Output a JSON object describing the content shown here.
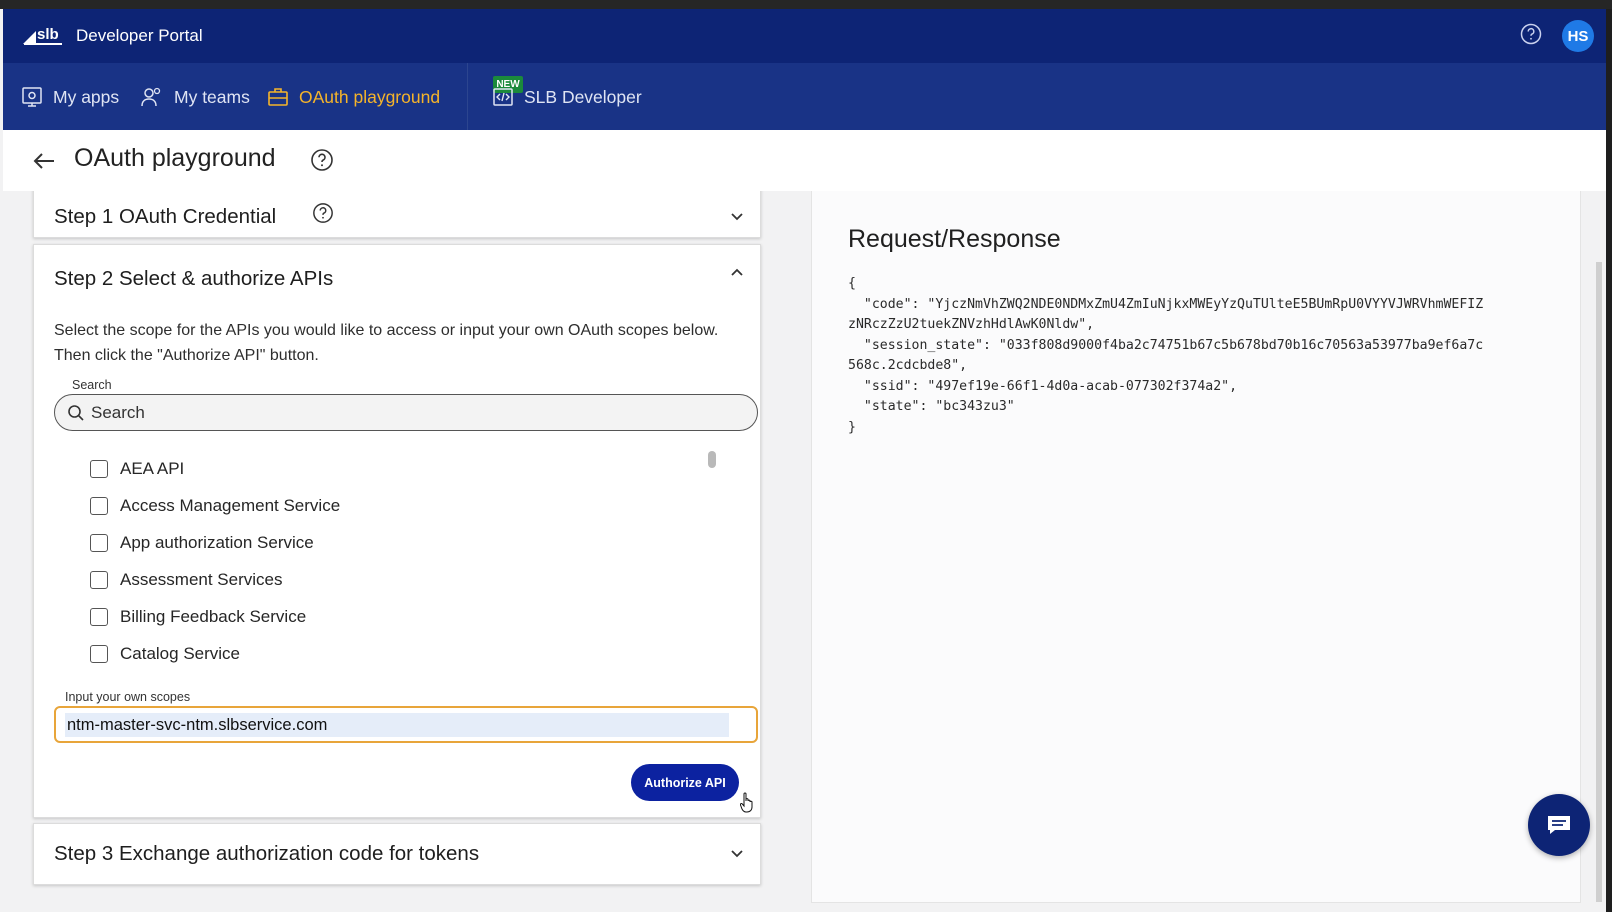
{
  "header": {
    "app_title": "Developer Portal",
    "avatar_initials": "HS",
    "brand_color": "#0d2475",
    "accent_color": "#f5b42a"
  },
  "nav": {
    "items": [
      {
        "label": "My apps",
        "icon": "apps-icon"
      },
      {
        "label": "My teams",
        "icon": "team-icon"
      },
      {
        "label": "OAuth playground",
        "icon": "briefcase-icon",
        "active": true
      },
      {
        "label": "SLB Developer",
        "icon": "code-icon",
        "badge": "NEW"
      }
    ]
  },
  "page": {
    "title": "OAuth playground"
  },
  "steps": {
    "step1": {
      "title": "Step 1 OAuth Credential"
    },
    "step2": {
      "title": "Step 2 Select & authorize APIs",
      "description": "Select the scope for the APIs you would like to access or input your own OAuth scopes below. Then click the \"Authorize API\" button.",
      "search_label": "Search",
      "search_placeholder": "Search",
      "apis": [
        "AEA API",
        "Access Management Service",
        "App authorization Service",
        "Assessment Services",
        "Billing Feedback Service",
        "Catalog Service"
      ],
      "scopes_label": "Input your own scopes",
      "scopes_value": "ntm-master-svc-ntm.slbservice.com",
      "authorize_label": "Authorize API"
    },
    "step3": {
      "title": "Step 3 Exchange authorization code for tokens"
    }
  },
  "response": {
    "title": "Request/Response",
    "body": "{\n  \"code\": \"YjczNmVhZWQ2NDE0NDMxZmU4ZmIuNjkxMWEyYzQuTUlteE5BUmRpU0VYYVJWRVhmWEFIZ\nzNRczZzU2tuekZNVzhHdlAwK0Nldw\",\n  \"session_state\": \"033f808d9000f4ba2c74751b67c5b678bd70b16c70563a53977ba9ef6a7c\n568c.2cdcbde8\",\n  \"ssid\": \"497ef19e-66f1-4d0a-acab-077302f374a2\",\n  \"state\": \"bc343zu3\"\n}"
  }
}
